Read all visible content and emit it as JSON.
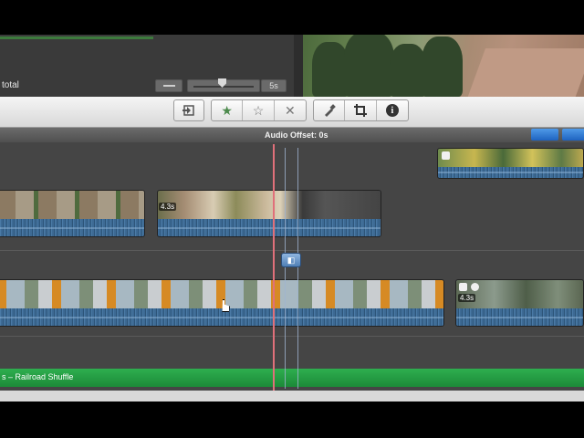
{
  "project": {
    "total_label": "total",
    "zoom_value": "5s"
  },
  "toolbar": {
    "import_icon": "import-icon",
    "favorite_icon": "filled-star-icon",
    "unfavorite_icon": "outline-star-icon",
    "reject_icon": "x-icon",
    "keyword_icon": "brush-icon",
    "crop_icon": "crop-icon",
    "info_icon": "info-icon",
    "favorite_glyph": "★",
    "unfavorite_glyph": "☆",
    "reject_glyph": "✕",
    "info_glyph": "i"
  },
  "timeline": {
    "audio_offset_label": "Audio Offset: 0s",
    "clip_duration_1": "4.3s",
    "clip_duration_2": "4.3s",
    "music_track_label": "s – Railroad Shuffle"
  },
  "colors": {
    "playhead": "#e0707a",
    "music_track": "#1f9a3f",
    "accent_blue": "#2e7cd6"
  }
}
